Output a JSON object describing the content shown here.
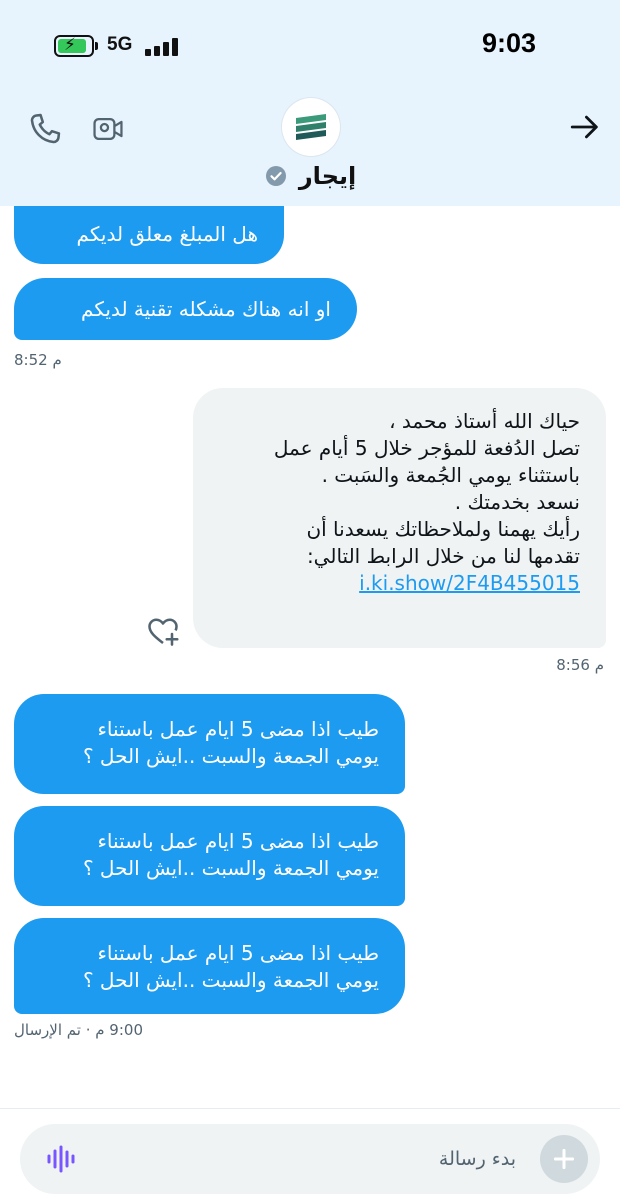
{
  "status_bar": {
    "time": "9:03",
    "network": "5G",
    "battery_state": "charging",
    "battery_color": "#34c759"
  },
  "header": {
    "contact_name": "إيجار",
    "verified": true,
    "icons": [
      "phone-icon",
      "video-icon",
      "back-arrow-icon"
    ]
  },
  "messages": [
    {
      "dir": "out",
      "lines": [
        "هل المبلغ معلق لديكم"
      ]
    },
    {
      "dir": "out",
      "lines": [
        "او انه هناك مشكله تقنية لديكم"
      ],
      "time": "8:52 م"
    },
    {
      "dir": "in",
      "lines": [
        "حياك الله أستاذ محمد ،",
        "تصل الدُفعة للمؤجر خلال 5 أيام عمل",
        "باستثناء يومي الجُمعة والسَبت .",
        "نسعد بخدمتك .",
        "رأيك يهمنا ولملاحظاتك يسعدنا أن",
        "تقدمها لنا من خلال الرابط التالي:"
      ],
      "link": "i.ki.show/2F4B455015",
      "time": "8:56 م"
    },
    {
      "dir": "out",
      "lines": [
        "طيب اذا مضى 5 ايام عمل باستناء",
        "يومي الجمعة والسبت ..ايش الحل ؟"
      ]
    },
    {
      "dir": "out",
      "lines": [
        "طيب اذا مضى 5 ايام عمل باستناء",
        "يومي الجمعة والسبت ..ايش الحل ؟"
      ]
    },
    {
      "dir": "out",
      "lines": [
        "طيب اذا مضى 5 ايام عمل باستناء",
        "يومي الجمعة والسبت ..ايش الحل ؟"
      ],
      "time": "9:00 م · تم الإرسال"
    }
  ],
  "composer": {
    "placeholder": "بدء رسالة",
    "value": ""
  },
  "colors": {
    "outgoing_bubble": "#1d9bf0",
    "incoming_bubble": "#eff3f4",
    "header_bg": "#e8f4fd",
    "voice_icon": "#7856ff"
  }
}
